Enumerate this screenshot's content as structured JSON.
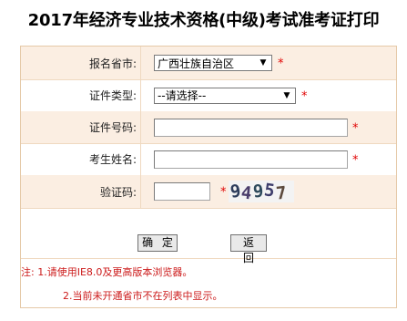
{
  "page": {
    "title": "2017年经济专业技术资格(中级)考试准考证打印"
  },
  "form": {
    "province": {
      "label": "报名省市:",
      "value": "广西壮族自治区"
    },
    "id_type": {
      "label": "证件类型:",
      "value": "--请选择--"
    },
    "id_number": {
      "label": "证件号码:",
      "value": ""
    },
    "name": {
      "label": "考生姓名:",
      "value": ""
    },
    "captcha": {
      "label": "验证码:",
      "value": "",
      "image_text": [
        "9",
        "4",
        "9",
        "5",
        "7"
      ]
    },
    "required_mark": "*"
  },
  "buttons": {
    "confirm": "确 定",
    "back": "返 回"
  },
  "notes": {
    "line1": "注: 1.请使用IE8.0及更高版本浏览器。",
    "line2": "2.当前未开通省市不在列表中显示。"
  },
  "colors": {
    "required": "#e00000",
    "note": "#cc1a1a",
    "row_alt": "#fbeee2",
    "border": "#e5c9a8"
  }
}
